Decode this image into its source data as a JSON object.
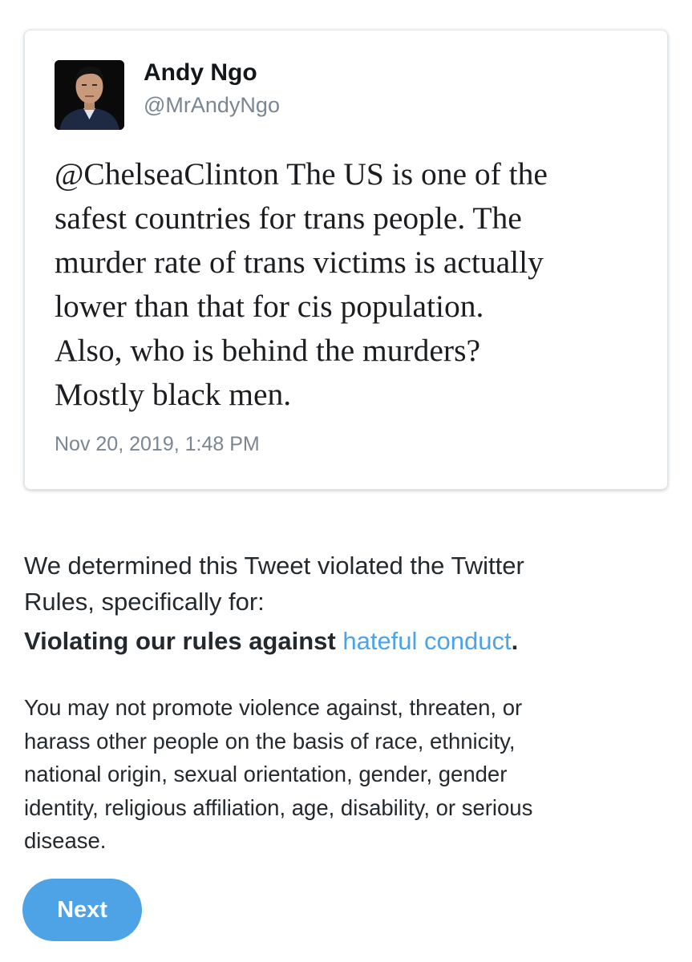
{
  "tweet": {
    "author_name": "Andy Ngo",
    "author_handle": "@MrAndyNgo",
    "text": "@ChelseaClinton The US is one of the\nsafest countries for trans people. The\nmurder rate of trans victims is actually\nlower than that for cis population.\nAlso, who is behind the murders?\nMostly black men.",
    "timestamp": "Nov 20, 2019, 1:48 PM"
  },
  "notice": {
    "line1": "We determined this Tweet violated the Twitter",
    "line2": "Rules, specifically for:",
    "violation_prefix": "Violating our rules against ",
    "violation_link": "hateful conduct",
    "violation_suffix": ".",
    "explanation": "You may not promote violence against, threaten, or\nharass other people on the basis of race, ethnicity,\nnational origin, sexual orientation, gender, gender\nidentity, religious affiliation, age, disability, or serious\ndisease."
  },
  "actions": {
    "next_label": "Next"
  },
  "colors": {
    "link": "#4da3e6",
    "button_background": "#4da3e6",
    "secondary_text": "#7a8691"
  }
}
